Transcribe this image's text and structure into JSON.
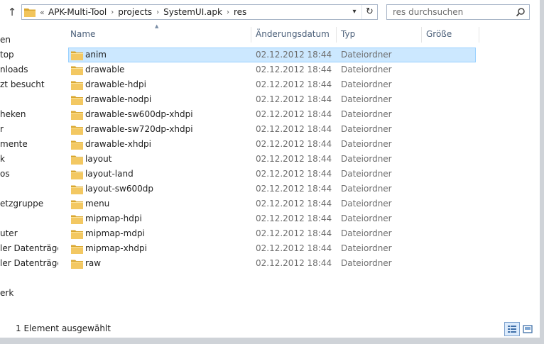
{
  "address": {
    "overflow": "«",
    "crumbs": [
      "APK-Multi-Tool",
      "projects",
      "SystemUI.apk",
      "res"
    ]
  },
  "search": {
    "placeholder": "res durchsuchen"
  },
  "nav": {
    "items": [
      "en",
      "top",
      "nloads",
      "zt besucht",
      "heken",
      "r",
      "mente",
      "k",
      "os",
      "etzgruppe",
      "uter",
      "ler Datenträger",
      "ler Datenträger",
      "erk"
    ]
  },
  "columns": {
    "name": "Name",
    "date": "Änderungsdatum",
    "type": "Typ",
    "size": "Größe"
  },
  "files": [
    {
      "name": "anim",
      "date": "02.12.2012 18:44",
      "type": "Dateiordner",
      "size": ""
    },
    {
      "name": "drawable",
      "date": "02.12.2012 18:44",
      "type": "Dateiordner",
      "size": ""
    },
    {
      "name": "drawable-hdpi",
      "date": "02.12.2012 18:44",
      "type": "Dateiordner",
      "size": ""
    },
    {
      "name": "drawable-nodpi",
      "date": "02.12.2012 18:44",
      "type": "Dateiordner",
      "size": ""
    },
    {
      "name": "drawable-sw600dp-xhdpi",
      "date": "02.12.2012 18:44",
      "type": "Dateiordner",
      "size": ""
    },
    {
      "name": "drawable-sw720dp-xhdpi",
      "date": "02.12.2012 18:44",
      "type": "Dateiordner",
      "size": ""
    },
    {
      "name": "drawable-xhdpi",
      "date": "02.12.2012 18:44",
      "type": "Dateiordner",
      "size": ""
    },
    {
      "name": "layout",
      "date": "02.12.2012 18:44",
      "type": "Dateiordner",
      "size": ""
    },
    {
      "name": "layout-land",
      "date": "02.12.2012 18:44",
      "type": "Dateiordner",
      "size": ""
    },
    {
      "name": "layout-sw600dp",
      "date": "02.12.2012 18:44",
      "type": "Dateiordner",
      "size": ""
    },
    {
      "name": "menu",
      "date": "02.12.2012 18:44",
      "type": "Dateiordner",
      "size": ""
    },
    {
      "name": "mipmap-hdpi",
      "date": "02.12.2012 18:44",
      "type": "Dateiordner",
      "size": ""
    },
    {
      "name": "mipmap-mdpi",
      "date": "02.12.2012 18:44",
      "type": "Dateiordner",
      "size": ""
    },
    {
      "name": "mipmap-xhdpi",
      "date": "02.12.2012 18:44",
      "type": "Dateiordner",
      "size": ""
    },
    {
      "name": "raw",
      "date": "02.12.2012 18:44",
      "type": "Dateiordner",
      "size": ""
    }
  ],
  "selected_index": 0,
  "status": {
    "text": "1 Element ausgewählt"
  },
  "colors": {
    "selection": "#cce8ff",
    "selection_border": "#99d1ff",
    "folder": "#e8b84a",
    "header_text": "#4c607a"
  }
}
